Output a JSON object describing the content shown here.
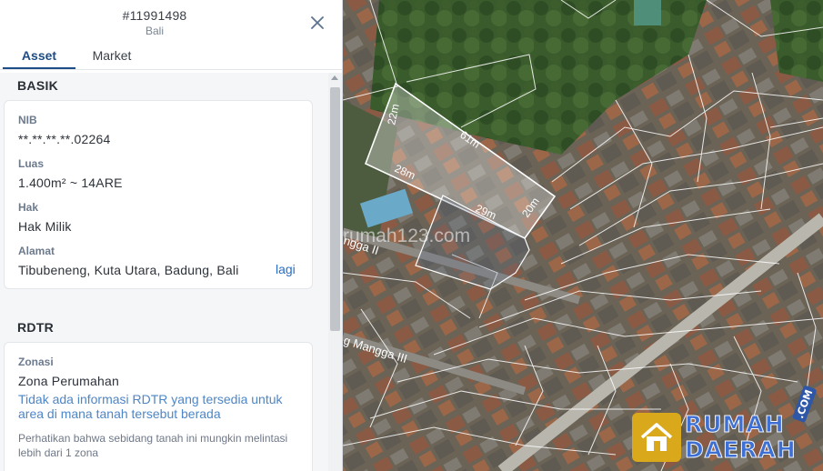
{
  "header": {
    "asset_id": "#11991498",
    "region": "Bali"
  },
  "tabs": [
    {
      "label": "Asset",
      "active": true
    },
    {
      "label": "Market",
      "active": false
    }
  ],
  "basik": {
    "title": "BASIK",
    "fields": [
      {
        "label": "NIB",
        "value": "**.**.**.**.02264"
      },
      {
        "label": "Luas",
        "value": "1.400m² ~ 14ARE"
      },
      {
        "label": "Hak",
        "value": "Hak Milik"
      },
      {
        "label": "Alamat",
        "value": "Tibubeneng, Kuta Utara, Badung, Bali"
      }
    ],
    "more_link": "lagi"
  },
  "rdtr": {
    "title": "RDTR",
    "zonasi_label": "Zonasi",
    "zonasi_value": "Zona Perumahan",
    "info": "Tidak ada informasi RDTR yang tersedia untuk area di mana tanah tersebut berada",
    "note": "Perhatikan bahwa sebidang tanah ini mungkin melintasi lebih dari 1 zona"
  },
  "map": {
    "streets": [
      "ngga II",
      "g Mangga III"
    ],
    "dimensions": [
      "22m",
      "61m",
      "28m",
      "29m",
      "20m"
    ],
    "watermark": "rumah123.com"
  },
  "logo": {
    "line1": "RUMAH",
    "line2": "DAERAH",
    "suffix": ".COM"
  },
  "colors": {
    "accent": "#1d4d86",
    "link": "#2a6cc7",
    "info": "#4e86c6",
    "parcel_outline": "#ffffff",
    "logo_blue": "#3e6fd2",
    "logo_gold": "#d9a81b"
  },
  "icons": {
    "close": "close-icon",
    "logo_house": "house-icon"
  }
}
